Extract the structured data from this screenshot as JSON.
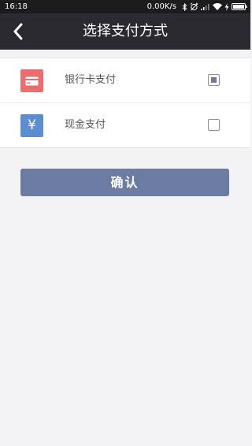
{
  "status_bar": {
    "time": "16:18",
    "network_speed": "0.00K/s",
    "icons": [
      "bluetooth-icon",
      "alarm-icon",
      "signal-icon",
      "wifi-icon",
      "charging-icon",
      "battery-icon"
    ]
  },
  "header": {
    "title": "选择支付方式",
    "back_icon": "chevron-left-icon"
  },
  "payment_methods": [
    {
      "label": "银行卡支付",
      "icon": "card-icon",
      "color": "#ec6d6f",
      "checked": true
    },
    {
      "label": "现金支付",
      "icon": "yuan-icon",
      "icon_text": "¥",
      "color": "#5c8ecf",
      "checked": false
    }
  ],
  "confirm_button": {
    "label": "确认"
  },
  "colors": {
    "header": "#2b2b2f",
    "status_bar": "#1c1c1e",
    "accent": "#6b7ba2",
    "background": "#f3f3f5"
  }
}
